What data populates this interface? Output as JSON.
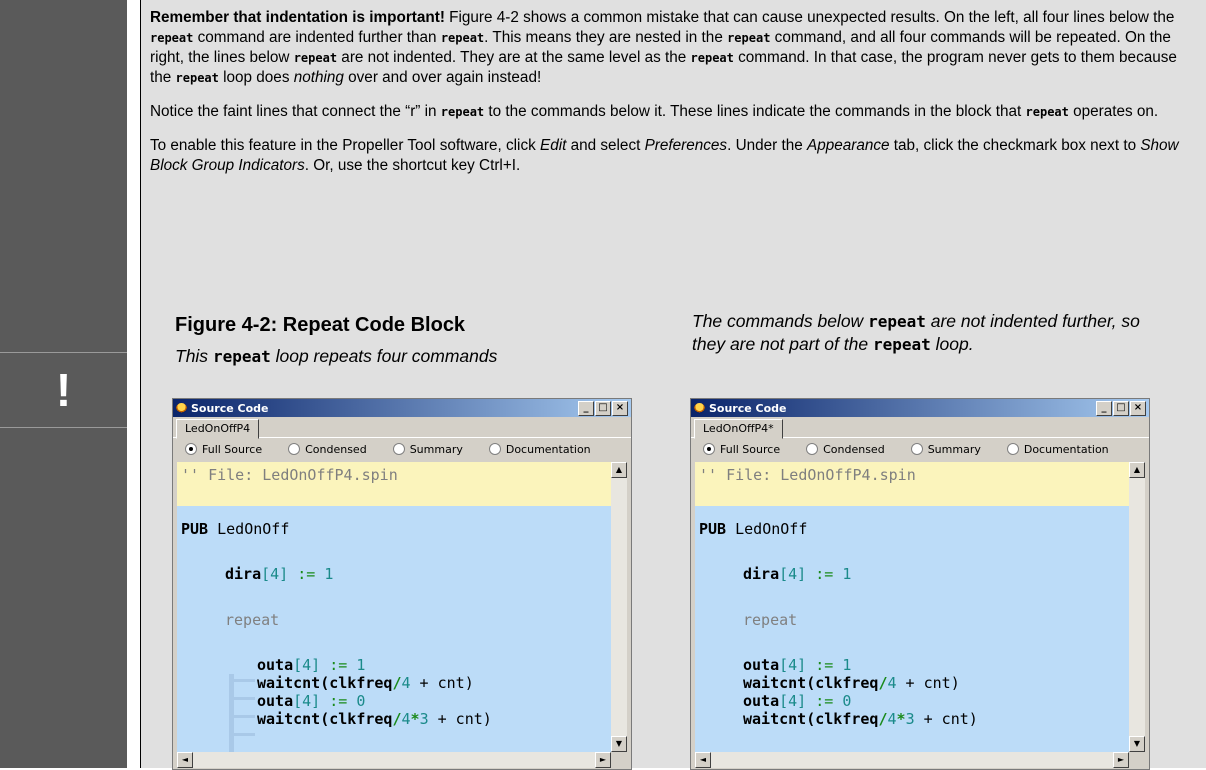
{
  "note": {
    "icon_symbol": "!",
    "p1_bold": "Remember that indentation is important!",
    "p1_a": " Figure 4-2 shows a common mistake that can cause unexpected results.  On the left, all four lines below the ",
    "kw_repeat": "repeat",
    "p1_b": " command are indented further than ",
    "p1_c": ".  This means they are nested in the ",
    "p1_d": " command, and all four commands will be repeated.  On the right, the lines below ",
    "p1_e": " are not indented.  They are at the same level as the ",
    "p1_f": " command.  In that case, the program never gets to them because the ",
    "p1_g": " loop does ",
    "p1_nothing": "nothing",
    "p1_h": " over and over again instead!",
    "p2_a": "Notice the faint lines that connect the “r” in ",
    "p2_b": " to the commands below it.  These lines indicate the commands in the block that ",
    "p2_c": " operates on.",
    "p3_a": "To enable this feature in the Propeller Tool software, click ",
    "p3_edit": "Edit",
    "p3_b": " and select ",
    "p3_prefs": "Preferences",
    "p3_c": ".  Under the ",
    "p3_appearance": "Appearance",
    "p3_d": " tab, click the checkmark box next to ",
    "p3_show": "Show Block Group Indicators",
    "p3_e": ".  Or, use the shortcut key Ctrl+I."
  },
  "figure": {
    "title": "Figure 4-2: Repeat Code Block",
    "caption_left_a": "This ",
    "caption_left_kw": "repeat",
    "caption_left_b": " loop repeats four commands",
    "caption_right_a": "The commands below ",
    "caption_right_kw": "repeat",
    "caption_right_b": " are not indented further, so they are not part of the ",
    "caption_right_kw2": "repeat",
    "caption_right_c": " loop."
  },
  "windows": [
    {
      "title": "Source Code",
      "tab": "LedOnOffP4",
      "radios": [
        "Full Source",
        "Condensed",
        "Summary",
        "Documentation"
      ],
      "selected_radio": "Full Source",
      "code": {
        "comment": "'' File: LedOnOffP4.spin",
        "pub": "PUB",
        "method": " LedOnOff",
        "dira": "dira",
        "idx4": "[4]",
        "assign": " := ",
        "one": "1",
        "zero": "0",
        "repeat": "repeat",
        "outa": "outa",
        "waitcnt_open": "waitcnt(clkfreq",
        "slash": "/",
        "four": "4",
        "plus_cnt": " + cnt)",
        "star": "*",
        "three": "3"
      }
    },
    {
      "title": "Source Code",
      "tab": "LedOnOffP4*",
      "radios": [
        "Full Source",
        "Condensed",
        "Summary",
        "Documentation"
      ],
      "selected_radio": "Full Source"
    }
  ],
  "window_buttons": [
    "_",
    "□",
    "×"
  ],
  "scroll_arrows": {
    "up": "▲",
    "down": "▼",
    "left": "◄",
    "right": "►"
  }
}
